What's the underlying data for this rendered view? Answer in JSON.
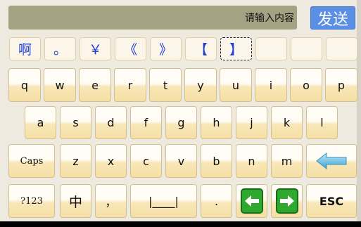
{
  "input": {
    "placeholder_text": "请输入内容"
  },
  "send": {
    "label": "发送"
  },
  "candidates": [
    "啊",
    "。",
    "￥",
    "《",
    "》",
    "【",
    "】",
    "",
    "",
    ""
  ],
  "row1": [
    "q",
    "w",
    "e",
    "r",
    "t",
    "y",
    "u",
    "i",
    "o",
    "p"
  ],
  "row2": [
    "a",
    "s",
    "d",
    "f",
    "g",
    "h",
    "j",
    "k",
    "l"
  ],
  "row3": {
    "caps": "Caps",
    "letters": [
      "z",
      "x",
      "c",
      "v",
      "b",
      "n",
      "m"
    ],
    "backspace_icon": "arrow-left-icon"
  },
  "row4": {
    "sym": "?123",
    "lang": "中",
    "comma": "，",
    "space": "|____|",
    "period": ".",
    "left_icon": "arrow-left-icon",
    "right_icon": "arrow-right-icon",
    "esc": "ESC"
  },
  "colors": {
    "accent": "#5b8fe6",
    "candidate_text": "#1f3fd4",
    "key_top": "#fffdf6",
    "key_bottom": "#f5dfa5",
    "nav_green": "#2fa82f"
  }
}
